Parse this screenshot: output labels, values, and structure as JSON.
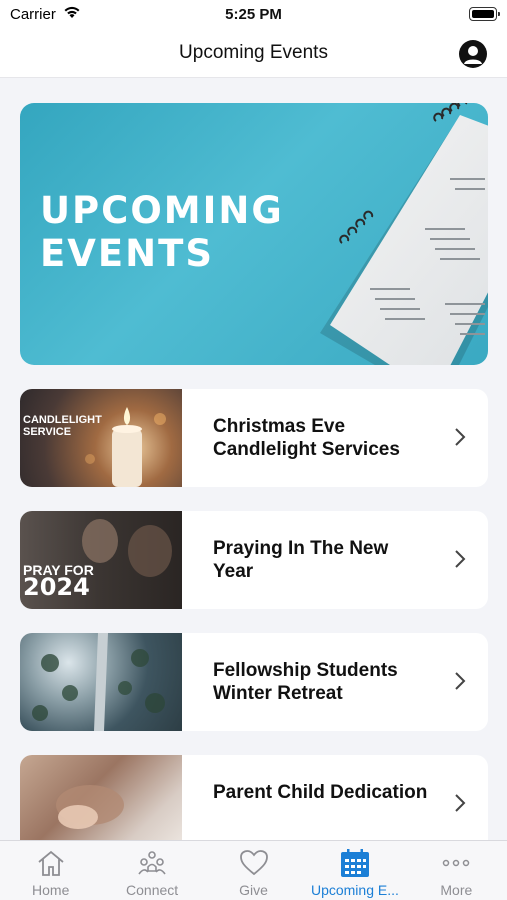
{
  "status_bar": {
    "carrier": "Carrier",
    "time": "5:25 PM"
  },
  "nav": {
    "title": "Upcoming Events"
  },
  "banner": {
    "line1": "UPCOMING",
    "line2": "EVENTS"
  },
  "events": [
    {
      "title": "Christmas Eve Candlelight Services",
      "thumb_title": "CANDLELIGHT SERVICE"
    },
    {
      "title": "Praying In The New Year",
      "thumb_pre": "PRAY FOR",
      "thumb_year": "2024"
    },
    {
      "title": "Fellowship Students Winter Retreat"
    },
    {
      "title": "Parent Child Dedication"
    }
  ],
  "tabs": [
    {
      "label": "Home",
      "icon": "house-icon"
    },
    {
      "label": "Connect",
      "icon": "people-icon"
    },
    {
      "label": "Give",
      "icon": "heart-icon"
    },
    {
      "label": "Upcoming E...",
      "icon": "calendar-icon",
      "active": true
    },
    {
      "label": "More",
      "icon": "ellipsis-icon"
    }
  ],
  "colors": {
    "accent": "#1c7fd6",
    "banner": "#4fbcd2",
    "tab_inactive": "#8e8e93"
  }
}
